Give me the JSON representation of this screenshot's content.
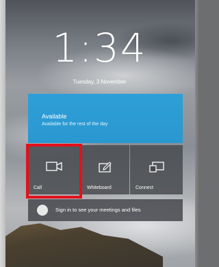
{
  "lock_screen": {
    "time": "1:34",
    "date": "Tuesday, 3 November"
  },
  "status": {
    "title": "Available",
    "subtitle": "Available for the rest of the day"
  },
  "tiles": [
    {
      "label": "Call",
      "icon": "video-camera-icon"
    },
    {
      "label": "Whiteboard",
      "icon": "whiteboard-pen-icon"
    },
    {
      "label": "Connect",
      "icon": "cast-screen-icon"
    }
  ],
  "signin": {
    "text": "Sign in to see your meetings and files"
  },
  "colors": {
    "status_card": "#2e9fd8",
    "tile": "#46484c",
    "highlight": "#e4101b"
  }
}
